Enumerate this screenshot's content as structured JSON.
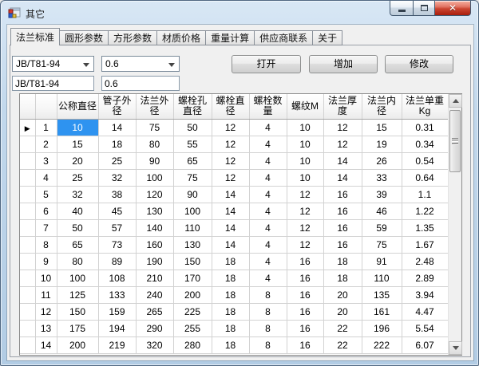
{
  "window": {
    "title": "其它"
  },
  "tabs": [
    {
      "label": "法兰标准",
      "selected": true
    },
    {
      "label": "圆形参数",
      "selected": false
    },
    {
      "label": "方形参数",
      "selected": false
    },
    {
      "label": "材质价格",
      "selected": false
    },
    {
      "label": "重量计算",
      "selected": false
    },
    {
      "label": "供应商联系",
      "selected": false
    },
    {
      "label": "关于",
      "selected": false
    }
  ],
  "controls": {
    "standard_dropdown": {
      "value": "JB/T81-94"
    },
    "pressure_dropdown": {
      "value": "0.6"
    },
    "standard_textbox": {
      "value": "JB/T81-94"
    },
    "pressure_textbox": {
      "value": "0.6"
    },
    "open_button": "打开",
    "add_button": "增加",
    "modify_button": "修改"
  },
  "grid": {
    "columns": [
      "公称直径",
      "管子外径",
      "法兰外径",
      "螺栓孔直径",
      "螺栓直径",
      "螺栓数量",
      "螺纹M",
      "法兰厚度",
      "法兰内径",
      "法兰单重Kg"
    ],
    "rows": [
      {
        "num": "1",
        "current": true,
        "values": [
          "10",
          "14",
          "75",
          "50",
          "12",
          "4",
          "10",
          "12",
          "15",
          "0.31"
        ]
      },
      {
        "num": "2",
        "current": false,
        "values": [
          "15",
          "18",
          "80",
          "55",
          "12",
          "4",
          "10",
          "12",
          "19",
          "0.34"
        ]
      },
      {
        "num": "3",
        "current": false,
        "values": [
          "20",
          "25",
          "90",
          "65",
          "12",
          "4",
          "10",
          "14",
          "26",
          "0.54"
        ]
      },
      {
        "num": "4",
        "current": false,
        "values": [
          "25",
          "32",
          "100",
          "75",
          "12",
          "4",
          "10",
          "14",
          "33",
          "0.64"
        ]
      },
      {
        "num": "5",
        "current": false,
        "values": [
          "32",
          "38",
          "120",
          "90",
          "14",
          "4",
          "12",
          "16",
          "39",
          "1.1"
        ]
      },
      {
        "num": "6",
        "current": false,
        "values": [
          "40",
          "45",
          "130",
          "100",
          "14",
          "4",
          "12",
          "16",
          "46",
          "1.22"
        ]
      },
      {
        "num": "7",
        "current": false,
        "values": [
          "50",
          "57",
          "140",
          "110",
          "14",
          "4",
          "12",
          "16",
          "59",
          "1.35"
        ]
      },
      {
        "num": "8",
        "current": false,
        "values": [
          "65",
          "73",
          "160",
          "130",
          "14",
          "4",
          "12",
          "16",
          "75",
          "1.67"
        ]
      },
      {
        "num": "9",
        "current": false,
        "values": [
          "80",
          "89",
          "190",
          "150",
          "18",
          "4",
          "16",
          "18",
          "91",
          "2.48"
        ]
      },
      {
        "num": "10",
        "current": false,
        "values": [
          "100",
          "108",
          "210",
          "170",
          "18",
          "4",
          "16",
          "18",
          "110",
          "2.89"
        ]
      },
      {
        "num": "11",
        "current": false,
        "values": [
          "125",
          "133",
          "240",
          "200",
          "18",
          "8",
          "16",
          "20",
          "135",
          "3.94"
        ]
      },
      {
        "num": "12",
        "current": false,
        "values": [
          "150",
          "159",
          "265",
          "225",
          "18",
          "8",
          "16",
          "20",
          "161",
          "4.47"
        ]
      },
      {
        "num": "13",
        "current": false,
        "values": [
          "175",
          "194",
          "290",
          "255",
          "18",
          "8",
          "16",
          "22",
          "196",
          "5.54"
        ]
      },
      {
        "num": "14",
        "current": false,
        "values": [
          "200",
          "219",
          "320",
          "280",
          "18",
          "8",
          "16",
          "22",
          "222",
          "6.07"
        ]
      }
    ],
    "selection": {
      "row_index": 0,
      "col_index": 0
    },
    "colors": {
      "selection_bg": "#2e93f0",
      "selection_text": "#ffffff"
    }
  }
}
